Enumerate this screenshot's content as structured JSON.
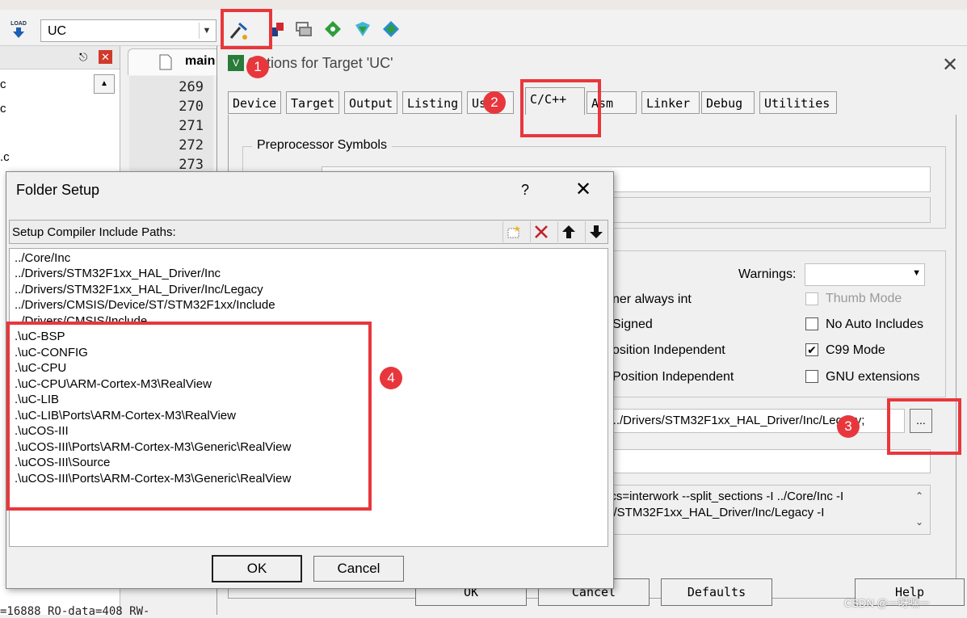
{
  "toolbar": {
    "target_value": "UC",
    "load_label": "LOAD",
    "icons": [
      "load-icon",
      "options-for-target-icon",
      "manage-components-icon",
      "file-extensions-icon",
      "run-icon",
      "pack-installer-icon",
      "select-software-packs-icon"
    ]
  },
  "editor": {
    "tab_label": "main",
    "line_numbers": [
      "269",
      "270",
      "271",
      "272",
      "273"
    ]
  },
  "project_pane": {
    "fragments": [
      "c",
      "c",
      "",
      ".c",
      ""
    ]
  },
  "options_dialog": {
    "title": "Options for Target 'UC'",
    "tabs": [
      "Device",
      "Target",
      "Output",
      "Listing",
      "User",
      "C/C++",
      "Asm",
      "Linker",
      "Debug",
      "Utilities"
    ],
    "preprocessor_group": "Preprocessor Symbols",
    "warnings_label": "Warnings:",
    "checks_right": [
      {
        "label": "Thumb Mode",
        "checked": false,
        "disabled": true
      },
      {
        "label": "No Auto Includes",
        "checked": false,
        "disabled": false
      },
      {
        "label": "C99 Mode",
        "checked": true,
        "disabled": false
      },
      {
        "label": "GNU extensions",
        "checked": false,
        "disabled": false
      }
    ],
    "checks_left_fragments": [
      "ner always int",
      "Signed",
      "osition Independent",
      "Position Independent"
    ],
    "include_paths_value": "c;../Drivers/STM32F1xx_HAL_Driver/Inc/Legacy;",
    "browse_label": "...",
    "compiler_string_line1": "pcs=interwork --split_sections -I ../Core/Inc -I",
    "compiler_string_line2": "rs/STM32F1xx_HAL_Driver/Inc/Legacy -I",
    "buttons": {
      "ok": "OK",
      "cancel": "Cancel",
      "defaults": "Defaults",
      "help": "Help"
    }
  },
  "folder_setup": {
    "title": "Folder Setup",
    "help_glyph": "?",
    "list_label": "Setup Compiler Include Paths:",
    "paths": [
      "../Core/Inc",
      "../Drivers/STM32F1xx_HAL_Driver/Inc",
      "../Drivers/STM32F1xx_HAL_Driver/Inc/Legacy",
      "../Drivers/CMSIS/Device/ST/STM32F1xx/Include",
      "../Drivers/CMSIS/Include",
      ".\\uC-BSP",
      ".\\uC-CONFIG",
      ".\\uC-CPU",
      ".\\uC-CPU\\ARM-Cortex-M3\\RealView",
      ".\\uC-LIB",
      ".\\uC-LIB\\Ports\\ARM-Cortex-M3\\RealView",
      ".\\uCOS-III",
      ".\\uCOS-III\\Ports\\ARM-Cortex-M3\\Generic\\RealView",
      ".\\uCOS-III\\Source",
      ".\\uCOS-III\\Ports\\ARM-Cortex-M3\\Generic\\RealView"
    ],
    "ok_label": "OK",
    "cancel_label": "Cancel"
  },
  "annotations": [
    "1",
    "2",
    "3",
    "4"
  ],
  "status_line": "=16888 RO-data=408 RW-",
  "watermark": "CSDN @一呀嘿一",
  "colors": {
    "annotation_red": "#e8373c",
    "dialog_bg": "#f0f0f0"
  }
}
